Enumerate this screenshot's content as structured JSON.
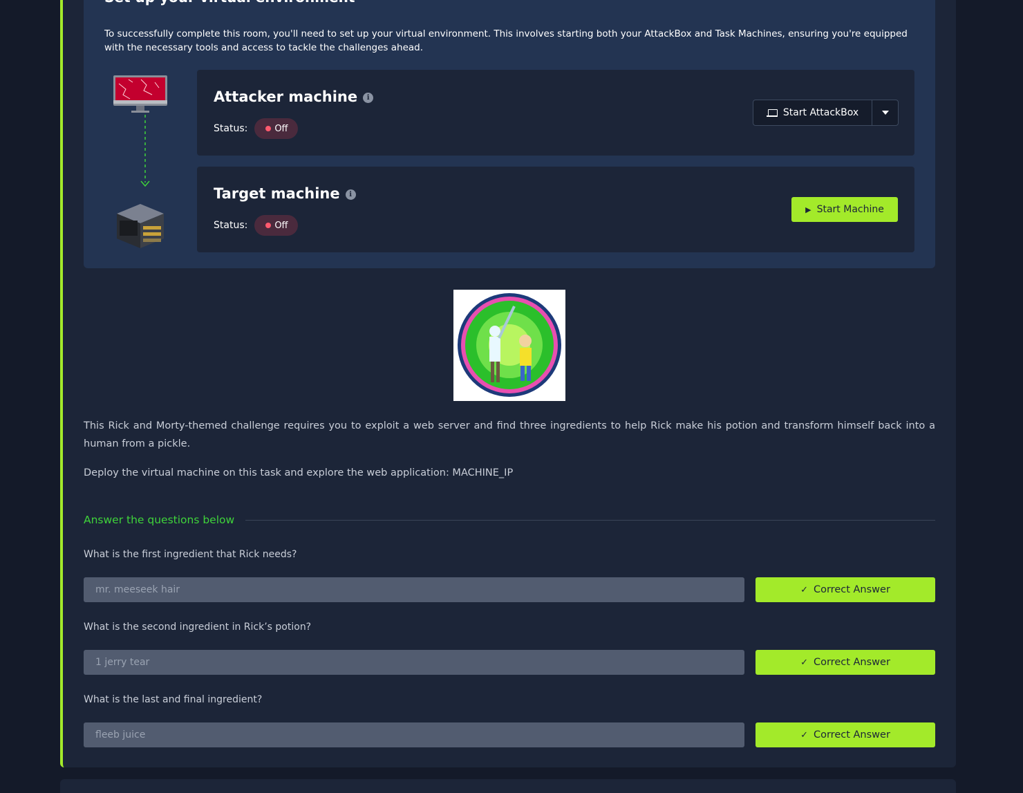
{
  "env": {
    "title": "Set up your virtual environment",
    "description": "To successfully complete this room, you'll need to set up your virtual environment. This involves starting both your AttackBox and Task Machines, ensuring you're equipped with the necessary tools and access to tackle the challenges ahead."
  },
  "attacker": {
    "title": "Attacker machine",
    "status_label": "Status:",
    "status_value": "Off",
    "button_label": "Start AttackBox"
  },
  "target": {
    "title": "Target machine",
    "status_label": "Status:",
    "status_value": "Off",
    "button_label": "Start Machine"
  },
  "content": {
    "paragraph1": "This Rick and Morty-themed challenge requires you to exploit a web server and find three ingredients to help Rick make his potion and transform himself back into a human from a pickle.",
    "paragraph2": "Deploy the virtual machine on this task and explore the web application: MACHINE_IP"
  },
  "questions_header": "Answer the questions below",
  "questions": [
    {
      "text": "What is the first ingredient that Rick needs?",
      "answer": "mr. meeseek hair",
      "button": "Correct Answer"
    },
    {
      "text": "What is the second ingredient in Rick’s potion?",
      "answer": "1 jerry tear",
      "button": "Correct Answer"
    },
    {
      "text": "What is the last and final ingredient?",
      "answer": "fleeb juice",
      "button": "Correct Answer"
    }
  ],
  "colors": {
    "accent": "#a3ea2a",
    "header_green": "#3fd33a",
    "status_off": "#ff5a6e"
  }
}
